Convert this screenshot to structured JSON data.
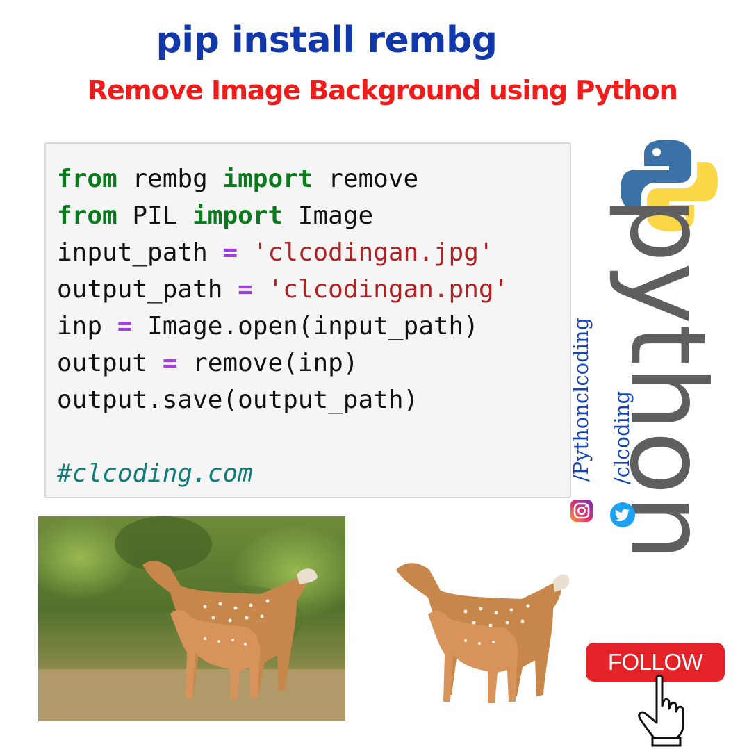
{
  "header": {
    "title": "pip install rembg",
    "subtitle": "Remove Image Background using Python"
  },
  "code": {
    "lines": [
      [
        "from",
        " rembg ",
        "import",
        " remove"
      ],
      [
        "from",
        " PIL ",
        "import",
        " Image"
      ],
      [
        "input_path ",
        "=",
        " ",
        "'clcodingan.jpg'"
      ],
      [
        "output_path ",
        "=",
        " ",
        "'clcodingan.png'"
      ],
      [
        "inp ",
        "=",
        " Image.open(input_path)"
      ],
      [
        "output ",
        "=",
        " remove(inp)"
      ],
      [
        "output.save(output_path)"
      ]
    ],
    "comment": "#clcoding.com"
  },
  "brand": {
    "word": "python",
    "instagram_handle": "/Pythonclcoding",
    "twitter_handle": "/clcoding",
    "instagram_icon": "instagram-icon",
    "twitter_icon": "twitter-icon",
    "logo_icon": "python-logo-icon"
  },
  "follow": {
    "label": "FOLLOW",
    "icon": "pointing-hand-icon"
  },
  "images": {
    "original": "deer-photo",
    "result": "deer-cutout"
  },
  "colors": {
    "title": "#1237a8",
    "subtitle": "#ef1c1c",
    "keyword": "#0b7a1c",
    "operator": "#a43ee0",
    "string": "#b32222",
    "comment": "#137c7a",
    "follow_button": "#e42328",
    "python_blue": "#3a72a8",
    "python_yellow": "#fbd748"
  }
}
